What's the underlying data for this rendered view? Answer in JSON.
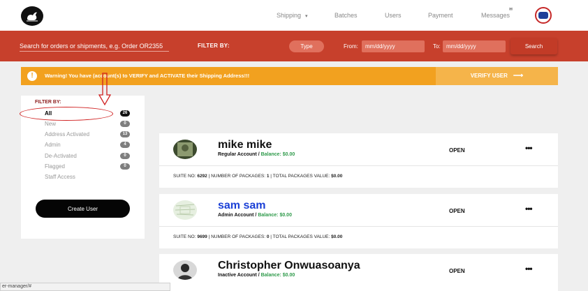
{
  "nav": {
    "links": [
      "Shipping",
      "Batches",
      "Users",
      "Payment",
      "Messages"
    ],
    "shipping_caret": "▾",
    "messages_badge": "✉"
  },
  "filter_bar": {
    "search_placeholder": "Search for orders or shipments, e.g. Order OR2355",
    "filter_label": "FILTER BY:",
    "type_label": "Type",
    "from_label": "From:",
    "to_label": "To:",
    "date_placeholder": "mm/dd/yyyy",
    "search_button": "Search"
  },
  "alert": {
    "icon": "!",
    "text": "Warning! You have (account(s) to VERIFY and ACTIVATE their Shipping Address!!!",
    "button": "VERIFY USER",
    "button_arrow": "⟶"
  },
  "sidebar": {
    "title": "FILTER BY:",
    "filters": [
      {
        "label": "All",
        "count": "26",
        "active": true
      },
      {
        "label": "New",
        "count": "0"
      },
      {
        "label": "Address Activated",
        "count": "13"
      },
      {
        "label": "Admin",
        "count": "4"
      },
      {
        "label": "De-Activated",
        "count": "0"
      },
      {
        "label": "Flagged",
        "count": "0"
      },
      {
        "label": "Staff Access",
        "count": ""
      }
    ],
    "create_button": "Create User"
  },
  "users": [
    {
      "name": "mike mike",
      "account": "Regular Account /",
      "balance_label": "Balance:",
      "balance": "$0.00",
      "status": "OPEN",
      "more": "•••",
      "suite_label": "SUITE NO:",
      "suite": "6292",
      "packages_label": "NUMBER OF PACKAGES:",
      "packages": "1",
      "value_label": "TOTAL PACKAGES VALUE:",
      "value": "$0.00"
    },
    {
      "name": "sam sam",
      "account": "Admin Account /",
      "balance_label": "Balance:",
      "balance": "$0.00",
      "status": "OPEN",
      "more": "•••",
      "suite_label": "SUITE NO:",
      "suite": "9699",
      "packages_label": "NUMBER OF PACKAGES:",
      "packages": "0",
      "value_label": "TOTAL PACKAGES VALUE:",
      "value": "$0.00"
    },
    {
      "name": "Christopher Onwuasoanya",
      "account": "Inactive Account /",
      "balance_label": "Balance:",
      "balance": "$0.00",
      "status": "OPEN",
      "more": "•••"
    }
  ],
  "statusbar": {
    "url": "er-manager/#"
  },
  "colors": {
    "header_red": "#c7402c",
    "alert_orange": "#f2a11f",
    "balance_green": "#2e9a4a",
    "name_blue": "#1a3fd6",
    "annotation_red": "#d02020"
  }
}
